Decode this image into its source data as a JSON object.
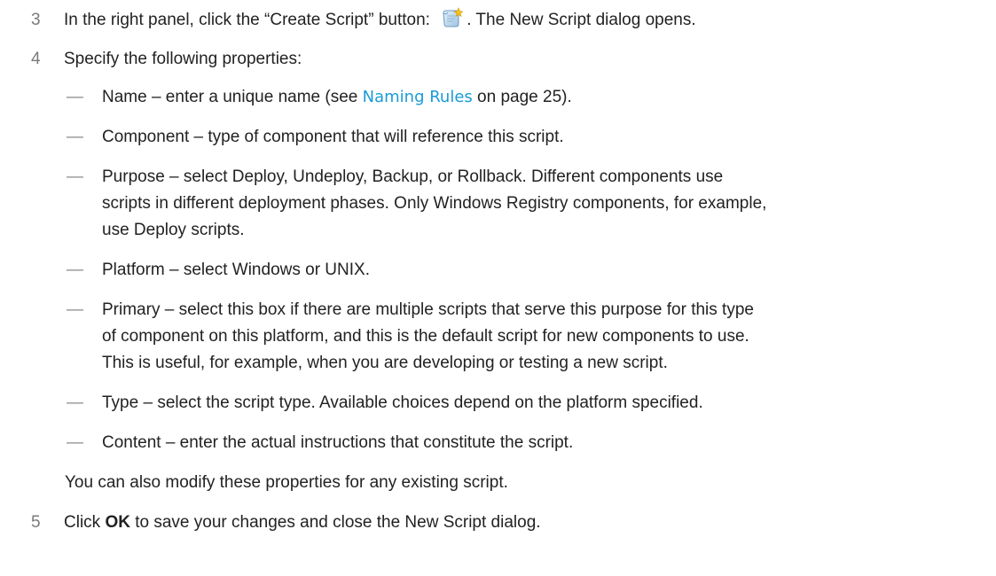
{
  "steps": [
    {
      "num": "3",
      "text_before": "In the right panel, click the “Create Script” button: ",
      "text_after": ". The New Script dialog opens.",
      "icon": "create-script-icon"
    },
    {
      "num": "4",
      "text": "Specify the following properties:"
    },
    {
      "num": "5",
      "text_before": "Click ",
      "bold": "OK",
      "text_after": " to save your changes and close the New Script dialog."
    }
  ],
  "properties": [
    {
      "dash": "—",
      "text_before": "Name – enter a unique name (see ",
      "link": "Naming Rules",
      "text_after": " on page 25)."
    },
    {
      "dash": "—",
      "text": "Component – type of component that will reference this script."
    },
    {
      "dash": "—",
      "text": "Purpose – select Deploy, Undeploy, Backup, or Rollback. Different components use scripts in different deployment phases. Only Windows Registry components, for example, use Deploy scripts."
    },
    {
      "dash": "—",
      "text": "Platform – select Windows or UNIX."
    },
    {
      "dash": "—",
      "text": "Primary – select this box if there are multiple scripts that serve this purpose for this type of component on this platform, and this is the default script for new components to use. This is useful, for example, when you are developing or testing a new script."
    },
    {
      "dash": "—",
      "text": "Type – select the script type. Available choices depend on the platform specified."
    },
    {
      "dash": "—",
      "text": "Content – enter the actual instructions that constitute the script."
    }
  ],
  "note": "You can also modify these properties for any existing script.",
  "colors": {
    "link": "#1a9bd7",
    "step_number": "#7a7a7a",
    "text": "#222222"
  }
}
